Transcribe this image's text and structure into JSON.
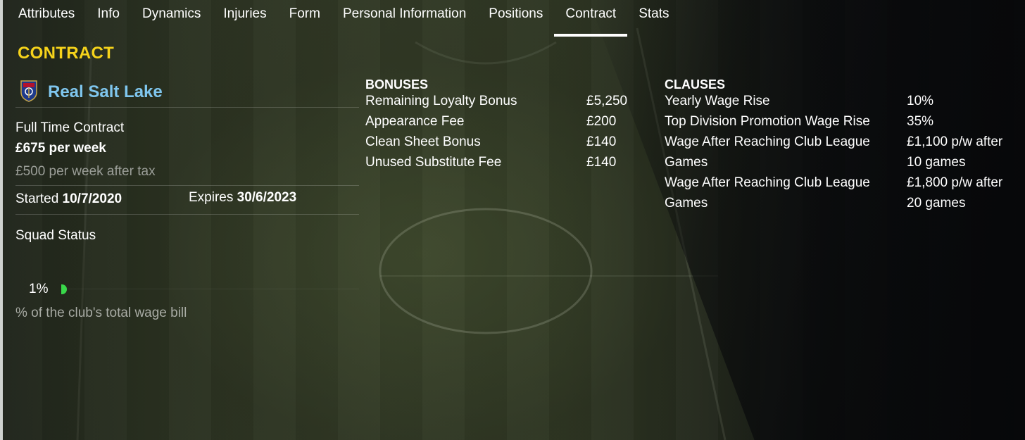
{
  "tabs": [
    {
      "label": "Attributes",
      "active": false
    },
    {
      "label": "Info",
      "active": false
    },
    {
      "label": "Dynamics",
      "active": false
    },
    {
      "label": "Injuries",
      "active": false
    },
    {
      "label": "Form",
      "active": false
    },
    {
      "label": "Personal Information",
      "active": false
    },
    {
      "label": "Positions",
      "active": false
    },
    {
      "label": "Contract",
      "active": true
    },
    {
      "label": "Stats",
      "active": false
    }
  ],
  "section_title": "CONTRACT",
  "club": {
    "name": "Real Salt Lake",
    "crest_icon": "real-salt-lake-crest-icon",
    "name_color": "#7fc6ee"
  },
  "contract": {
    "type": "Full Time Contract",
    "wage": "£675 per week",
    "wage_after_tax": "£500 per week after tax",
    "started_label": "Started",
    "started_value": "10/7/2020",
    "expires_label": "Expires",
    "expires_value": "30/6/2023",
    "squad_status_label": "Squad Status",
    "wage_bill_percent": "1%",
    "wage_bill_fraction": 0.01,
    "wage_bill_caption": "% of the club's total wage bill"
  },
  "bonuses": {
    "title": "BONUSES",
    "items": [
      {
        "label": "Remaining Loyalty Bonus",
        "value": "£5,250"
      },
      {
        "label": "Appearance Fee",
        "value": "£200"
      },
      {
        "label": "Clean Sheet Bonus",
        "value": "£140"
      },
      {
        "label": "Unused Substitute Fee",
        "value": "£140"
      }
    ]
  },
  "clauses": {
    "title": "CLAUSES",
    "items": [
      {
        "label_lines": [
          "Yearly Wage Rise"
        ],
        "value_lines": [
          "10%"
        ]
      },
      {
        "label_lines": [
          "Top Division Promotion Wage Rise"
        ],
        "value_lines": [
          "35%"
        ]
      },
      {
        "label_lines": [
          "Wage After Reaching Club League",
          "Games"
        ],
        "value_lines": [
          "£1,100 p/w after",
          "10 games"
        ]
      },
      {
        "label_lines": [
          "Wage After Reaching Club League",
          "Games"
        ],
        "value_lines": [
          "£1,800 p/w after",
          "20 games"
        ]
      }
    ]
  },
  "colors": {
    "accent_title": "#f6d31b",
    "progress_green": "#39d84a"
  }
}
